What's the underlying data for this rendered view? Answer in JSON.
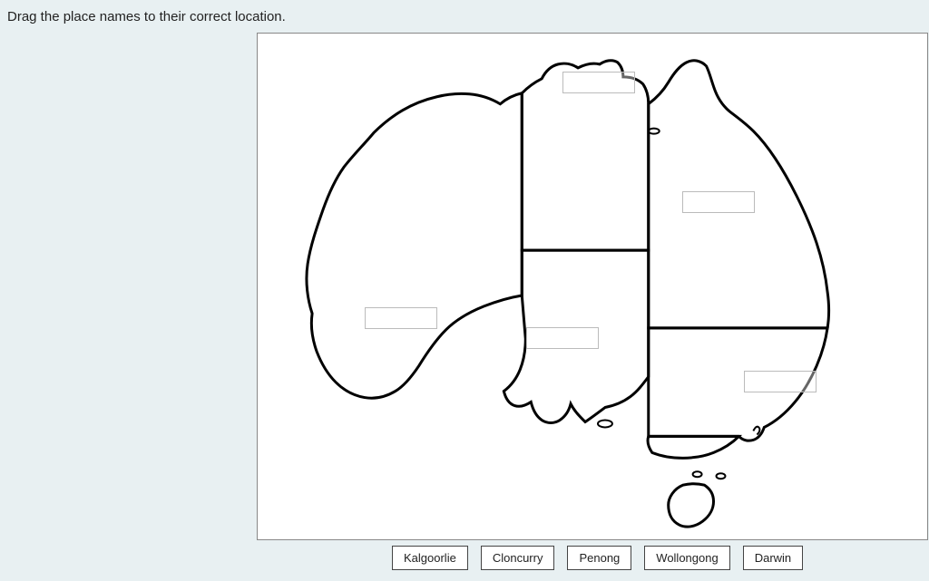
{
  "instruction": "Drag the place names to their correct location.",
  "labels": {
    "kalgoorlie": "Kalgoorlie",
    "cloncurry": "Cloncurry",
    "penong": "Penong",
    "wollongong": "Wollongong",
    "darwin": "Darwin"
  }
}
